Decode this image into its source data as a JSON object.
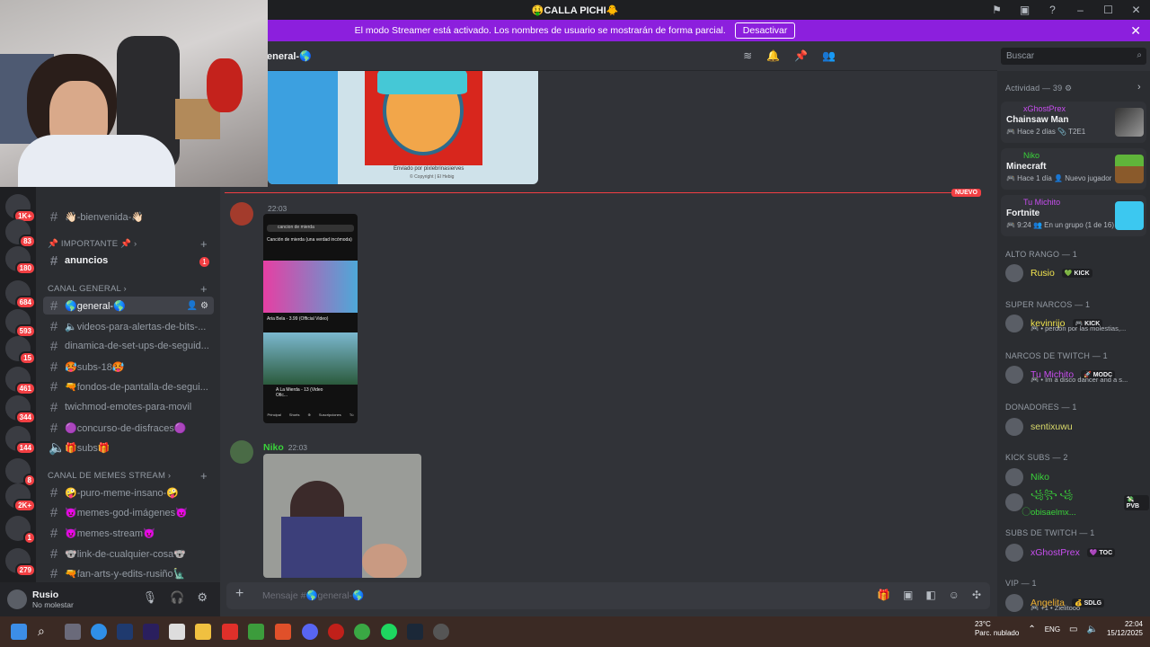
{
  "window": {
    "title": "🤑CALLA PICHI🐥",
    "controls": [
      "minimize",
      "maximize",
      "close"
    ]
  },
  "banner": {
    "text": "El modo Streamer está activado. Los nombres de usuario se mostrarán de forma parcial.",
    "button": "Desactivar",
    "bg": "#8c1fdd"
  },
  "header": {
    "channel": "eneral-🌎",
    "search_placeholder": "Buscar"
  },
  "servers": [
    {
      "badge": "1K+"
    },
    {
      "badge": "83"
    },
    {
      "badge": "180"
    },
    {
      "badge": "684"
    },
    {
      "badge": "593"
    },
    {
      "badge": "15"
    },
    {
      "badge": "461"
    },
    {
      "badge": "344"
    },
    {
      "badge": "144"
    },
    {
      "badge": "8"
    },
    {
      "badge": "2K+"
    },
    {
      "badge": "1"
    },
    {
      "badge": "279"
    }
  ],
  "sidebar": {
    "channels_top": [
      {
        "label": "👋🏻-bienvenida-👋🏻"
      }
    ],
    "categories": {
      "importante": "📌 IMPORTANTE 📌 ›",
      "canal_general": "CANAL GENERAL ›",
      "canal_memes": "CANAL DE MEMES STREAM ›"
    },
    "anuncios": {
      "label": "anuncios",
      "badge": "1"
    },
    "general_channels": [
      {
        "label": "🌎general-🌎",
        "active": true
      },
      {
        "label": "🔈videos-para-alertas-de-bits-..."
      },
      {
        "label": "dinamica-de-set-ups-de-seguid..."
      },
      {
        "label": "🥵subs-18🥵"
      },
      {
        "label": "🔫fondos-de-pantalla-de-segui..."
      },
      {
        "label": "twichmod-emotes-para-movil"
      },
      {
        "label": "🟣concurso-de-disfraces🟣"
      },
      {
        "label": "🎁subs🎁",
        "voice": true
      }
    ],
    "meme_channels": [
      {
        "label": "🤪-puro-meme-insano-🤪"
      },
      {
        "label": "😈memes-god-imágenes😈"
      },
      {
        "label": "😈memes-stream😈"
      },
      {
        "label": "🐨link-de-cualquier-cosa🐨"
      },
      {
        "label": "🔫fan-arts-y-edits-rusiño🗽"
      }
    ]
  },
  "user": {
    "name": "Rusio",
    "status": "No molestar"
  },
  "messages": {
    "attachment_caption": "Enviado por pixlebrinasierves",
    "attachment_sub": "© Copyright | El Hebig",
    "new_tag": "NUEVO",
    "msg1": {
      "author": "",
      "time": "22:03"
    },
    "phone": {
      "search": "cancion de mierda",
      "video1_title": "Canción de mierda (una verdad incómoda)",
      "video2_title": "Aria Bela - 3.99 (Official Video)",
      "video3_title": "A La Mierda - 13 (Video Ofic...",
      "nav": [
        "Principal",
        "Shorts",
        "",
        "Suscripciones",
        "Tú"
      ]
    },
    "msg2": {
      "author": "Niko",
      "time": "22:03"
    }
  },
  "composer": {
    "placeholder": "Mensaje #🌎general-🌎"
  },
  "members": {
    "activity_header": "Actividad — 39 ⚙",
    "activities": [
      {
        "user": "xGhostPrex",
        "game": "Chainsaw Man",
        "detail": "🎮 Hace 2 días  📎 T2E1"
      },
      {
        "user": "Niko",
        "game": "Minecraft",
        "detail": "🎮 Hace 1 día  👤 Nuevo jugador"
      },
      {
        "user": "Tu Michito",
        "game": "Fortnite",
        "detail": "🎮 9:24  👥 En un grupo (1 de 16)"
      }
    ],
    "sections": [
      {
        "title": "ALTO RANGO — 1",
        "members": [
          {
            "name": "Rusio",
            "tag": "💚 KICK",
            "color": "#f0e34f"
          }
        ]
      },
      {
        "title": "SUPER NARCOS — 1",
        "members": [
          {
            "name": "kevinrijo",
            "tag": "🎮 KICK",
            "sub": "🎮 • perdón por las molestias,...",
            "color": "#f0e34f"
          }
        ]
      },
      {
        "title": "NARCOS DE TWITCH — 1",
        "members": [
          {
            "name": "Tu Michito",
            "tag": "🚀 MODC",
            "sub": "🎮 • Im a disco dancer and a s...",
            "color": "#c84ef0"
          }
        ]
      },
      {
        "title": "DONADORES — 1",
        "members": [
          {
            "name": "sentixuwu",
            "tag": "",
            "color": "#d9d96a"
          }
        ]
      },
      {
        "title": "KICK SUBS — 2",
        "members": [
          {
            "name": "Niko",
            "tag": "",
            "color": "#3ad33a"
          },
          {
            "name": "꧁꧂ ꧁ ⃝obisaelmx...",
            "tag": "💸 PVB",
            "color": "#3ad33a"
          }
        ]
      },
      {
        "title": "SUBS DE TWITCH — 1",
        "members": [
          {
            "name": "xGhostPrex",
            "tag": "💜 TOC",
            "color": "#c84ef0"
          }
        ]
      },
      {
        "title": "VIP — 1",
        "members": [
          {
            "name": "Angelita",
            "tag": "💰 SDLG",
            "sub": "🎮 +1 • Zielitooo",
            "color": "#f0b132"
          }
        ]
      }
    ]
  },
  "taskbar": {
    "weather": "23°C",
    "weather_desc": "Parc. nublado",
    "lang": "ENG",
    "time": "22:04",
    "date": "15/12/2025"
  }
}
